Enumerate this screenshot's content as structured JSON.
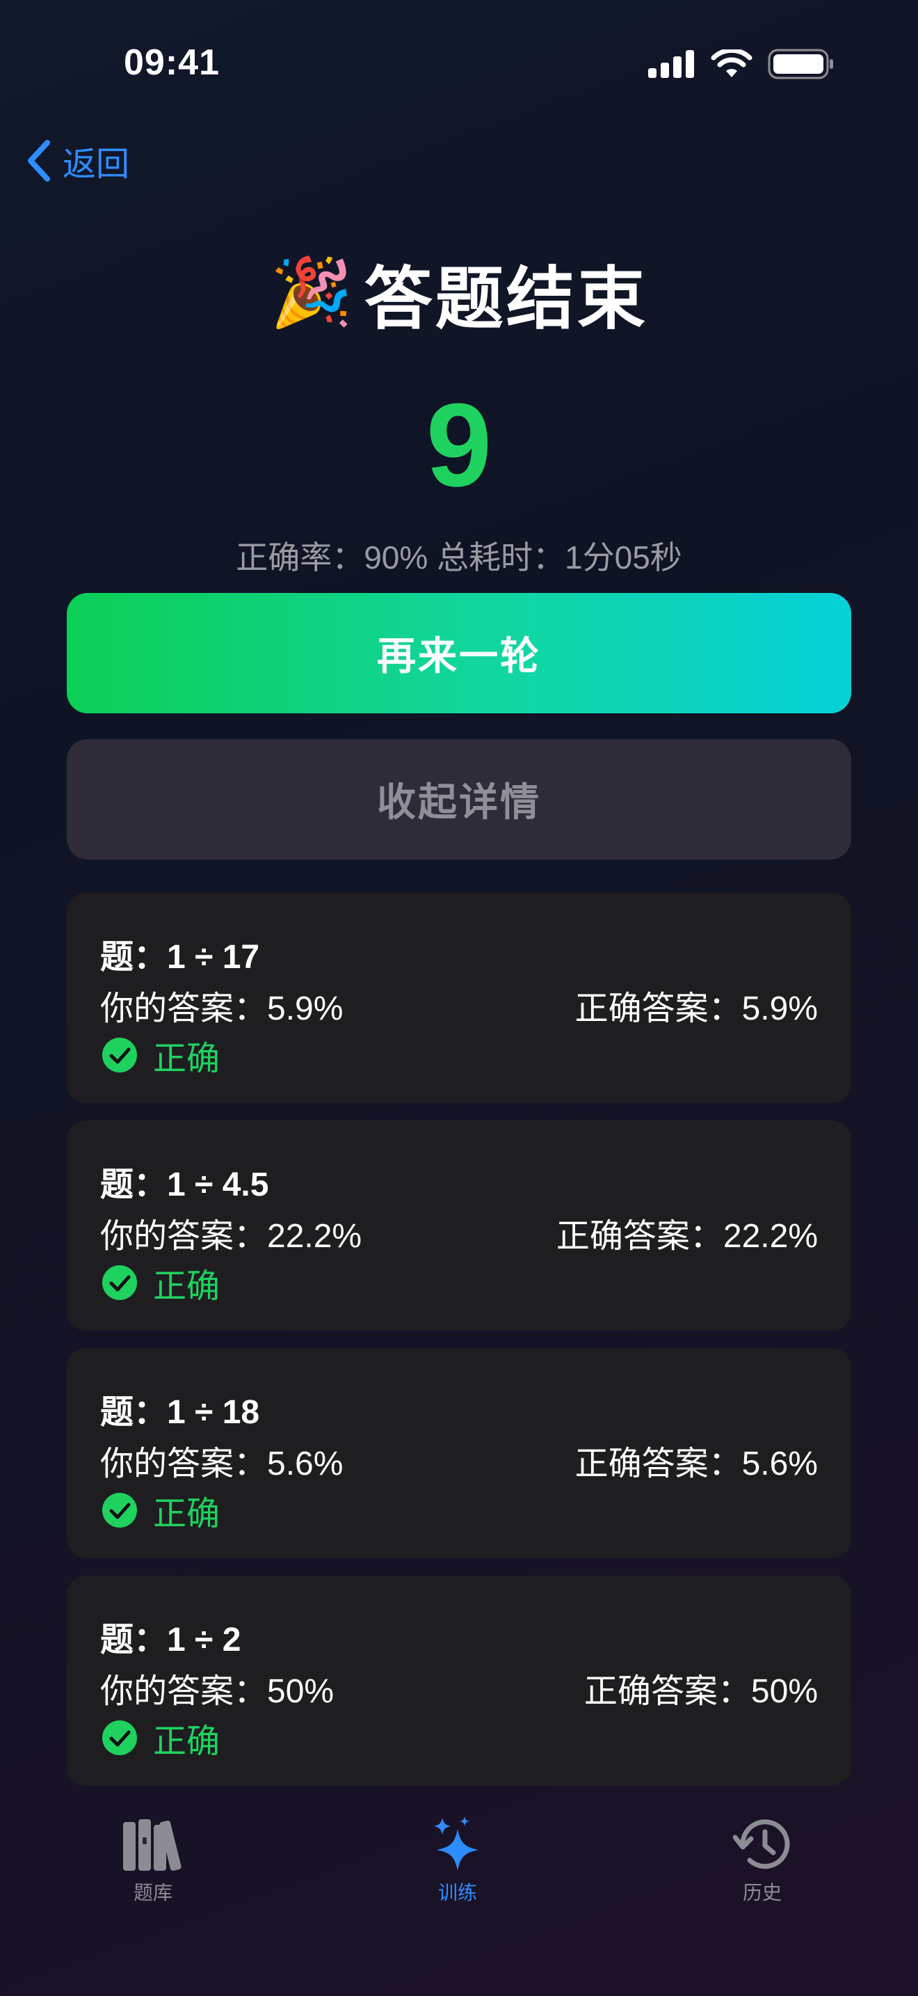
{
  "status": {
    "time": "09:41"
  },
  "nav": {
    "back_label": "返回"
  },
  "header": {
    "emoji": "🎉",
    "title": "答题结束"
  },
  "result": {
    "score": "9",
    "stats": "正确率：90%  总耗时：1分05秒"
  },
  "actions": {
    "retry_label": "再来一轮",
    "collapse_label": "收起详情"
  },
  "questions": [
    {
      "question": "题：1 ÷ 17",
      "your_answer": "你的答案：5.9%",
      "correct_answer": "正确答案：5.9%",
      "result": "正确"
    },
    {
      "question": "题：1 ÷ 4.5",
      "your_answer": "你的答案：22.2%",
      "correct_answer": "正确答案：22.2%",
      "result": "正确"
    },
    {
      "question": "题：1 ÷ 18",
      "your_answer": "你的答案：5.6%",
      "correct_answer": "正确答案：5.6%",
      "result": "正确"
    },
    {
      "question": "题：1 ÷ 2",
      "your_answer": "你的答案：50%",
      "correct_answer": "正确答案：50%",
      "result": "正确"
    }
  ],
  "tabs": [
    {
      "label": "题库",
      "icon": "books-icon",
      "active": false
    },
    {
      "label": "训练",
      "icon": "sparkles-icon",
      "active": true
    },
    {
      "label": "历史",
      "icon": "history-icon",
      "active": false
    }
  ],
  "colors": {
    "accent": "#2f8cff",
    "success": "#1fd25f",
    "card": "#1e1e21"
  }
}
